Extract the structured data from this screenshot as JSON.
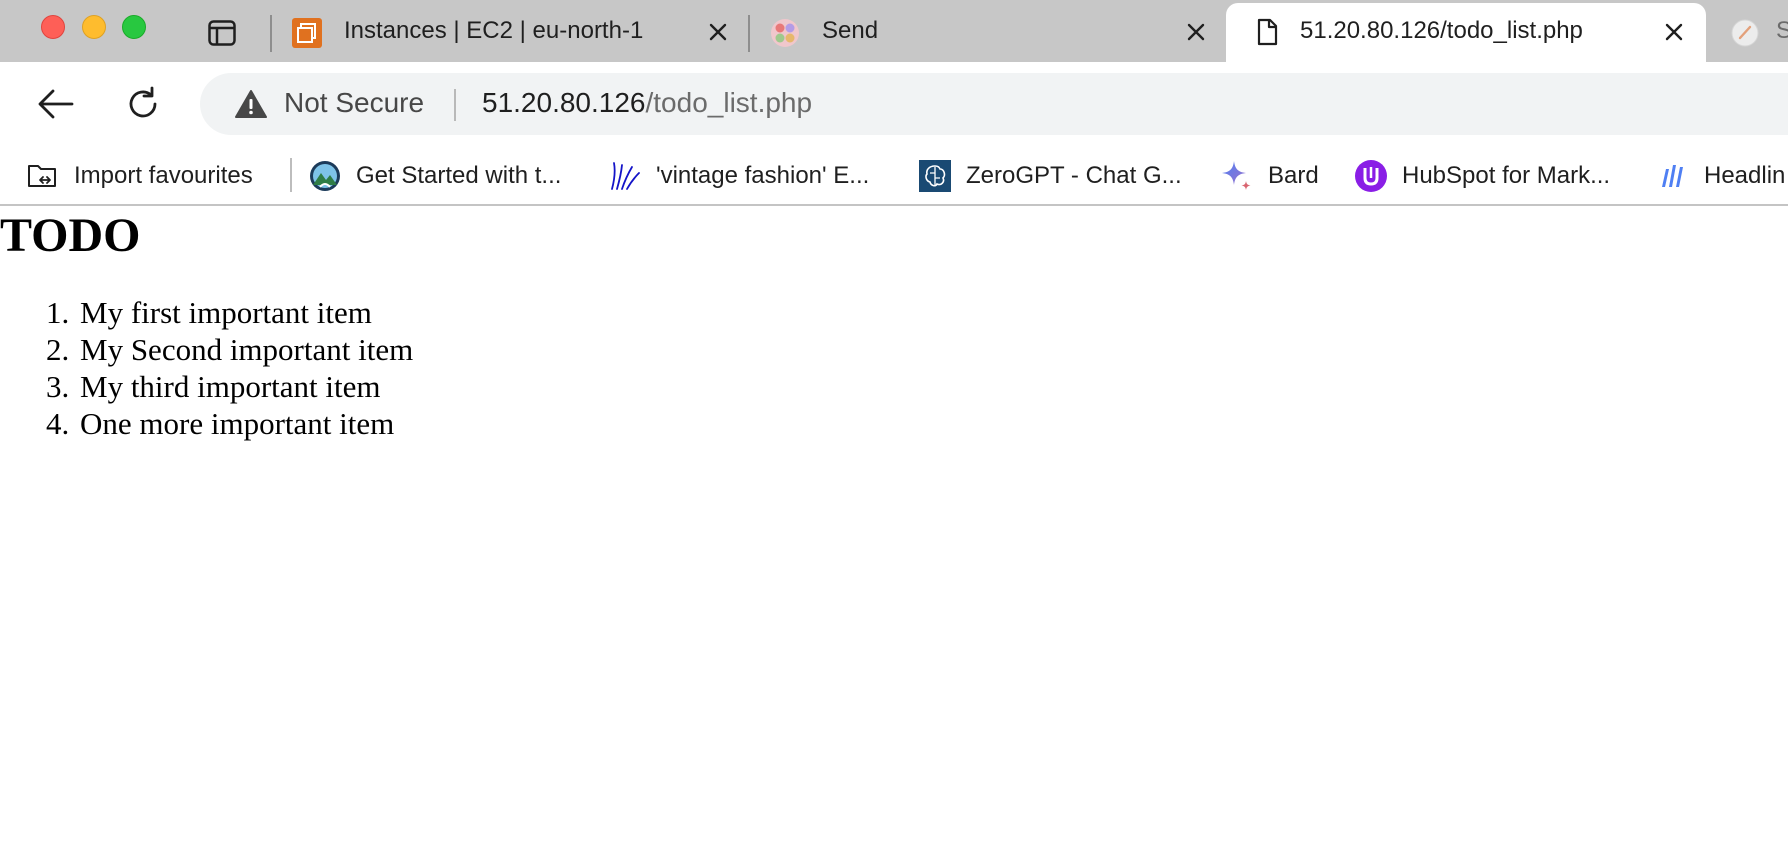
{
  "browser": {
    "tabs": [
      {
        "title": "Instances | EC2 | eu-north-1",
        "favicon": "aws-ec2-icon",
        "active": false
      },
      {
        "title": "Send",
        "favicon": "send-app-icon",
        "active": false
      },
      {
        "title": "51.20.80.126/todo_list.php",
        "favicon": "page-icon",
        "active": true
      },
      {
        "title": "S",
        "favicon": "partial-tab-icon",
        "active": false
      }
    ],
    "omnibox": {
      "security_label": "Not Secure",
      "url_host": "51.20.80.126",
      "url_path": "/todo_list.php"
    },
    "bookmarks": [
      {
        "label": "Import favourites",
        "icon": "import-folder-icon"
      },
      {
        "label": "Get Started with t...",
        "icon": "mountain-badge-icon"
      },
      {
        "label": "'vintage fashion' E...",
        "icon": "blue-lines-icon"
      },
      {
        "label": "ZeroGPT - Chat G...",
        "icon": "brain-icon"
      },
      {
        "label": "Bard",
        "icon": "sparkle-icon"
      },
      {
        "label": "HubSpot for Mark...",
        "icon": "hubspot-u-icon"
      },
      {
        "label": "Headlin",
        "icon": "bars-icon"
      }
    ]
  },
  "page": {
    "heading": "TODO",
    "items": [
      {
        "number": "1.",
        "text": "My first important item"
      },
      {
        "number": "2.",
        "text": "My Second important item"
      },
      {
        "number": "3.",
        "text": "My third important item"
      },
      {
        "number": "4.",
        "text": "One more important item"
      }
    ]
  },
  "colors": {
    "tabstrip_bg": "#c7c7c7",
    "close_red": "#fe5f57",
    "minimize_yellow": "#febc2e",
    "zoom_green": "#28c840"
  }
}
